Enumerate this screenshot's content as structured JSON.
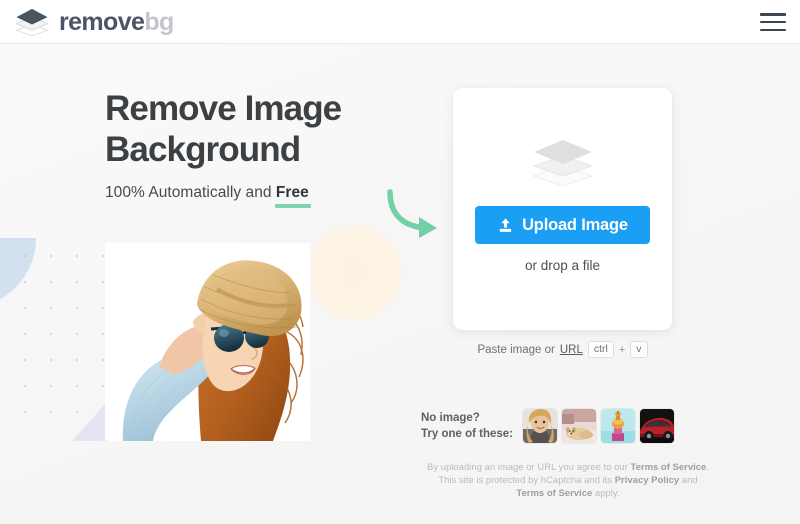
{
  "header": {
    "brand_primary": "remove",
    "brand_secondary": "bg",
    "logo_icon": "layers-icon",
    "menu_icon": "hamburger-menu-icon"
  },
  "hero": {
    "headline_line1": "Remove Image",
    "headline_line2": "Background",
    "subhead_prefix": "100% Automatically and ",
    "subhead_highlight": "Free",
    "photo_alt": "woman-in-straw-hat-and-sunglasses",
    "arrow_icon": "curved-arrow-icon",
    "accent_color": "#7fd4ae"
  },
  "upload_card": {
    "layers_icon": "layers-placeholder-icon",
    "upload_icon": "upload-arrow-icon",
    "upload_label": "Upload Image",
    "drop_text": "or drop a file",
    "button_color": "#1a9ff4"
  },
  "paste": {
    "text_prefix": "Paste image or ",
    "link_label": "URL",
    "key_ctrl": "ctrl",
    "key_plus": "+",
    "key_v": "v"
  },
  "samples": {
    "label_line1": "No image?",
    "label_line2": "Try one of these:",
    "thumbnails": [
      {
        "name": "sample-woman",
        "alt": "blonde woman portrait"
      },
      {
        "name": "sample-dog",
        "alt": "dog lying on bed"
      },
      {
        "name": "sample-product",
        "alt": "perfume bottle product shot"
      },
      {
        "name": "sample-car",
        "alt": "red suv car"
      }
    ]
  },
  "legal": {
    "line1_a": "By uploading an image or URL you agree to our ",
    "line1_link": "Terms of Service",
    "line1_b": ".",
    "line2_a": "This site is protected by hCaptcha and its ",
    "line2_link": "Privacy Policy",
    "line2_b": " and",
    "line3_link": "Terms of Service",
    "line3_b": " apply."
  }
}
